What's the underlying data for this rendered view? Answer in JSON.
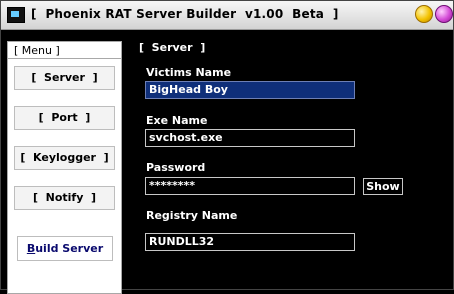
{
  "window": {
    "title": "[  Phoenix RAT Server Builder  v1.00  Beta  ]"
  },
  "menu": {
    "header": "[ Menu ]",
    "items": [
      {
        "label": "[  Server  ]"
      },
      {
        "label": "[  Port  ]"
      },
      {
        "label": "[  Keylogger  ]"
      },
      {
        "label": "[  Notify  ]"
      }
    ],
    "build_prefix": "B",
    "build_rest": "uild Server"
  },
  "server": {
    "title": "[  Server  ]",
    "victims_name_label": "Victims Name",
    "victims_name_value": "BigHead Boy",
    "exe_name_label": "Exe Name",
    "exe_name_value": "svchost.exe",
    "password_label": "Password",
    "password_value": "********",
    "show_label": "Show",
    "registry_name_label": "Registry Name",
    "registry_name_value": "RUNDLL32"
  }
}
